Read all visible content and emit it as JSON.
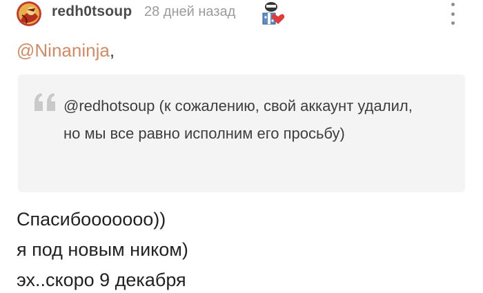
{
  "comment": {
    "author": "redh0tsoup",
    "time_ago": "28 дней назад",
    "mention": "@Ninaninja",
    "mention_suffix": ",",
    "quote": {
      "mention": "@redhotsoup",
      "text": " (к сожалению, свой аккаунт удалил, но мы все равно исполним его просьбу)"
    },
    "body_lines": [
      "Спасибоооoooo))",
      "я под новым ником)",
      "эх..скоро 9 декабря"
    ]
  },
  "icons": {
    "avatar": "user-avatar",
    "badge": "award-badge-icon",
    "more": "more-vertical-icon",
    "quote": "quote-mark-icon"
  },
  "colors": {
    "mention": "#d18a63",
    "author": "#4a4a4a",
    "timestamp": "#9b9b9b",
    "quote_background": "#f4f4f4"
  }
}
